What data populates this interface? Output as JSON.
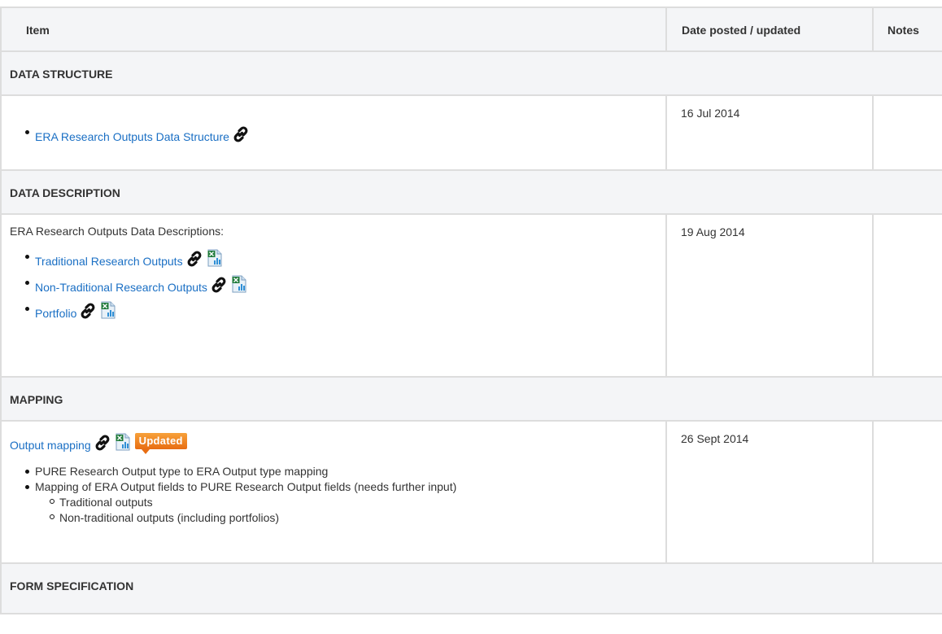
{
  "headers": {
    "item": "Item",
    "date": "Date posted /  updated",
    "notes": "Notes"
  },
  "sections": {
    "structure": {
      "title": "DATA STRUCTURE",
      "link": "ERA Research Outputs Data Structure",
      "date": "16 Jul 2014"
    },
    "description": {
      "title": "DATA DESCRIPTION",
      "intro": "ERA Research Outputs Data Descriptions:",
      "links": [
        "Traditional Research Outputs",
        "Non-Traditional Research Outputs",
        "Portfolio"
      ],
      "date": "19 Aug 2014"
    },
    "mapping": {
      "title": "MAPPING",
      "link": "Output mapping",
      "badge": "Updated",
      "bullets": [
        "PURE Research Output type to ERA Output type mapping",
        "Mapping of ERA Output fields to PURE Research Output fields (needs further input)"
      ],
      "sub_bullets": [
        "Traditional outputs",
        "Non-traditional outputs (including portfolios)"
      ],
      "date": "26 Sept 2014"
    },
    "form": {
      "title": "FORM SPECIFICATION"
    }
  },
  "icons": [
    "link-icon",
    "excel-file-icon"
  ],
  "colors": {
    "link": "#1a6fc4",
    "header_bg": "#f4f5f7",
    "border": "#dddddd",
    "badge": "#f08a24"
  }
}
